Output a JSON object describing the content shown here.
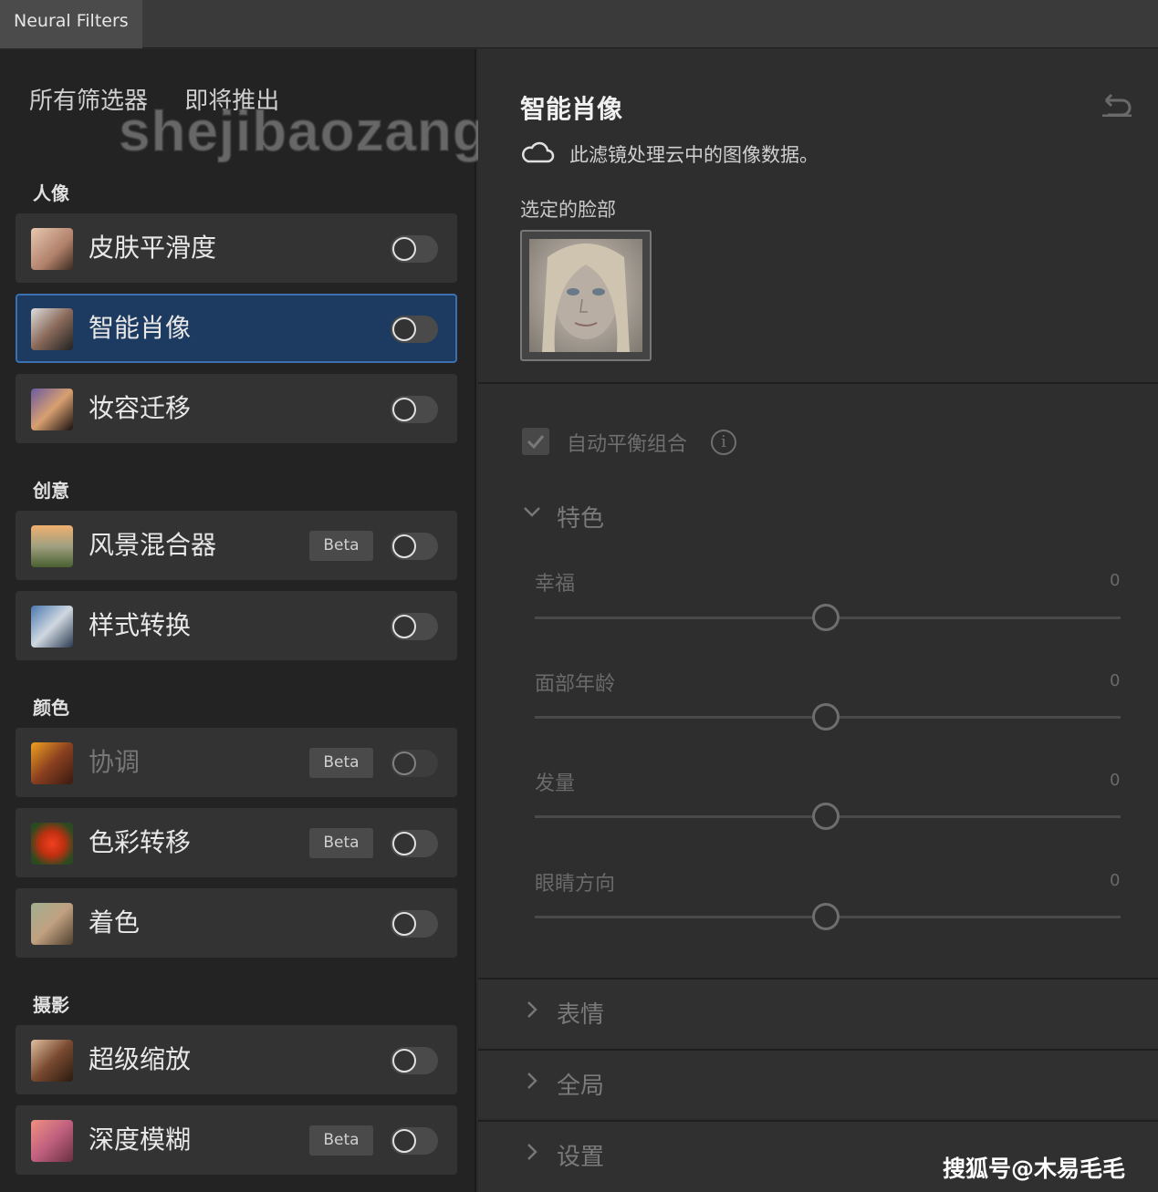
{
  "window": {
    "tab_title": "Neural Filters"
  },
  "left": {
    "tabs": [
      "所有筛选器",
      "即将推出"
    ],
    "watermark": "shejibaozang.com",
    "categories": [
      {
        "label": "人像"
      },
      {
        "label": "创意"
      },
      {
        "label": "颜色"
      },
      {
        "label": "摄影"
      }
    ],
    "filters": [
      {
        "label": "皮肤平滑度",
        "beta": "",
        "on": false
      },
      {
        "label": "智能肖像",
        "beta": "",
        "on": false,
        "selected": true
      },
      {
        "label": "妆容迁移",
        "beta": "",
        "on": false
      },
      {
        "label": "风景混合器",
        "beta": "Beta",
        "on": false
      },
      {
        "label": "样式转换",
        "beta": "",
        "on": false
      },
      {
        "label": "协调",
        "beta": "Beta",
        "on": false,
        "disabled": true
      },
      {
        "label": "色彩转移",
        "beta": "Beta",
        "on": false
      },
      {
        "label": "着色",
        "beta": "",
        "on": false
      },
      {
        "label": "超级缩放",
        "beta": "",
        "on": false
      },
      {
        "label": "深度模糊",
        "beta": "Beta",
        "on": false
      }
    ]
  },
  "right": {
    "title": "智能肖像",
    "cloud_notice": "此滤镜处理云中的图像数据。",
    "selected_face_label": "选定的脸部",
    "auto_balance_label": "自动平衡组合",
    "auto_balance_checked": true,
    "section_featured": "特色",
    "sliders": [
      {
        "label": "幸福",
        "value": "0"
      },
      {
        "label": "面部年龄",
        "value": "0"
      },
      {
        "label": "发量",
        "value": "0"
      },
      {
        "label": "眼睛方向",
        "value": "0"
      }
    ],
    "collapsed_sections": [
      "表情",
      "全局",
      "设置"
    ]
  },
  "credit": "搜狐号@木易毛毛",
  "colors": {
    "selected_row": "#1d3a60",
    "selected_border": "#3a6fb0",
    "panel_bg": "#232323"
  }
}
